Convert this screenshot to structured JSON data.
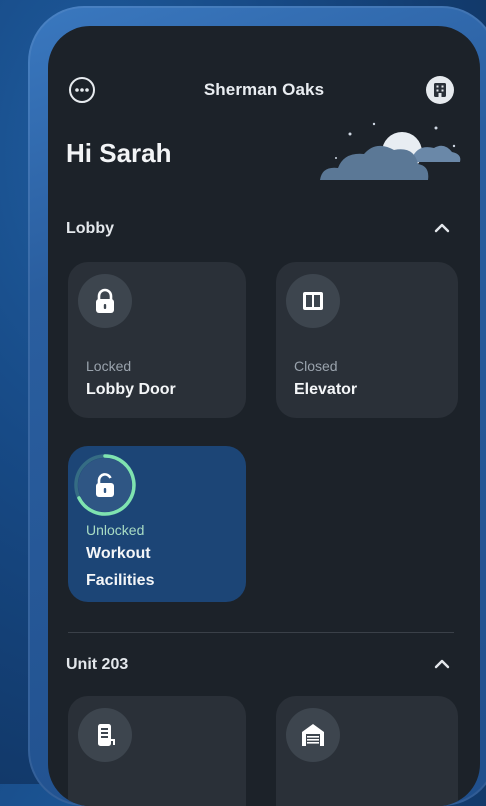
{
  "header": {
    "location": "Sherman Oaks",
    "greeting": "Hi Sarah"
  },
  "colors": {
    "screen_bg": "#1c2229",
    "card_bg": "#2a3038",
    "card_active_bg": "#1c4576",
    "accent_green": "#7fe3b0",
    "status_text": "#9aa3ad"
  },
  "sections": [
    {
      "label": "Lobby",
      "cards": [
        {
          "status": "Locked",
          "name": "Lobby Door",
          "icon": "lock-icon"
        },
        {
          "status": "Closed",
          "name": "Elevator",
          "icon": "elevator-icon"
        },
        {
          "status": "Unlocked",
          "name_line1": "Workout",
          "name_line2": "Facilities",
          "icon": "unlocked-lock-icon",
          "active": true
        }
      ]
    },
    {
      "label": "Unit 203",
      "cards": [
        {
          "icon": "smart-lock-keypad-icon"
        },
        {
          "icon": "garage-icon"
        }
      ]
    }
  ]
}
